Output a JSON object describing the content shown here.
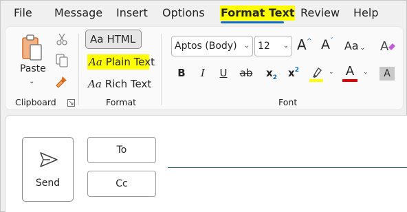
{
  "tabs": [
    {
      "label": "File"
    },
    {
      "label": "Message"
    },
    {
      "label": "Insert"
    },
    {
      "label": "Options"
    },
    {
      "label": "Format Text"
    },
    {
      "label": "Review"
    },
    {
      "label": "Help"
    }
  ],
  "active_tab": "Format Text",
  "highlight_color": "#ffff00",
  "accent_color": "#0f6cbd",
  "clipboard": {
    "paste_label": "Paste",
    "group_label": "Clipboard"
  },
  "format": {
    "html_label": "HTML",
    "plain_label": "Plain Text",
    "rich_label": "Rich Text",
    "aa_glyph": "Aa",
    "group_label": "Format"
  },
  "font": {
    "family_value": "Aptos (Body)",
    "size_value": "12",
    "group_label": "Font",
    "bold": "B",
    "italic": "I",
    "underline": "U",
    "strikethrough": "ab",
    "subscript": "x",
    "sub_mark": "2",
    "superscript": "x",
    "super_mark": "2",
    "grow": "A",
    "shrink": "A",
    "change_case": "Aa",
    "font_color": "A",
    "shade": "A",
    "font_color_swatch": "#e00000",
    "highlight_swatch": "#ffff00"
  },
  "compose": {
    "send_label": "Send",
    "to_label": "To",
    "cc_label": "Cc"
  }
}
